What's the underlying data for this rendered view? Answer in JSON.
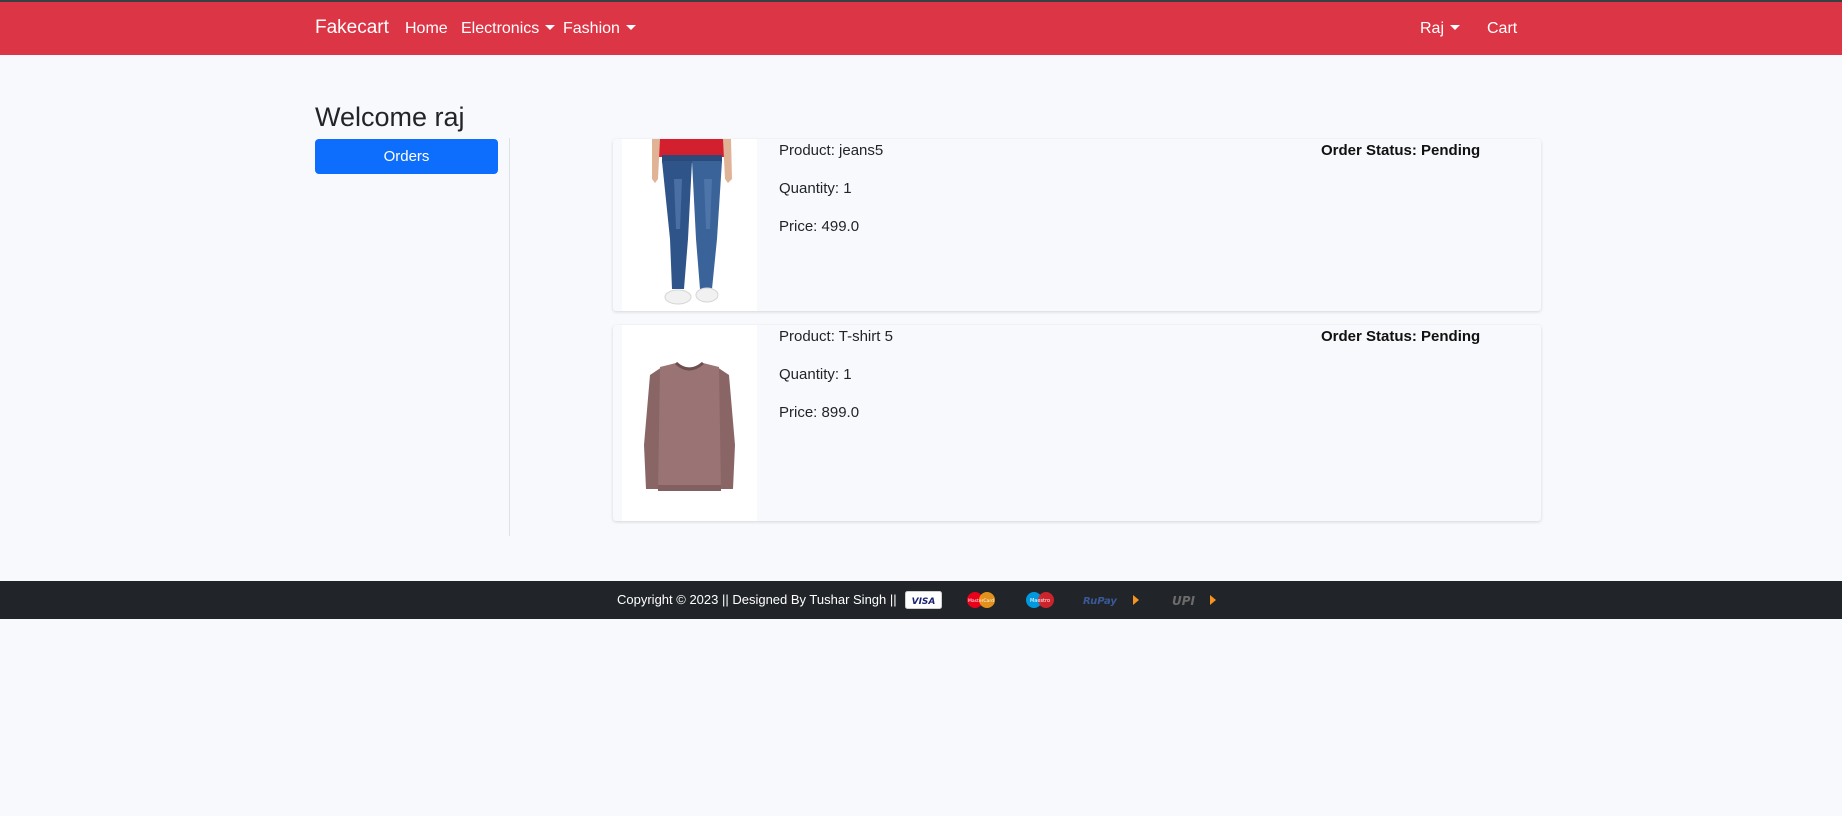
{
  "navbar": {
    "brand": "Fakecart",
    "home": "Home",
    "electronics": "Electronics",
    "fashion": "Fashion",
    "user": "Raj",
    "cart": "Cart",
    "color": "#dc3545"
  },
  "page": {
    "welcome": "Welcome raj"
  },
  "sidebar": {
    "orders_label": "Orders"
  },
  "orders": [
    {
      "product": "Product: jeans5",
      "quantity": "Quantity: 1",
      "price": "Price: 499.0",
      "status": "Order Status: Pending",
      "image": "jeans-image"
    },
    {
      "product": "Product: T-shirt 5",
      "quantity": "Quantity: 1",
      "price": "Price: 899.0",
      "status": "Order Status: Pending",
      "image": "tshirt-image"
    }
  ],
  "footer": {
    "copyright": "Copyright © 2023 || Designed By Tushar Singh ||",
    "payment_icons": [
      "visa-icon",
      "mastercard-icon",
      "maestro-icon",
      "rupay-icon",
      "upi-icon"
    ],
    "visa_text": "VISA",
    "mastercard_text": "MasterCard",
    "maestro_text": "Maestro",
    "rupay_text": "RuPay",
    "upi_text": "UPI"
  }
}
